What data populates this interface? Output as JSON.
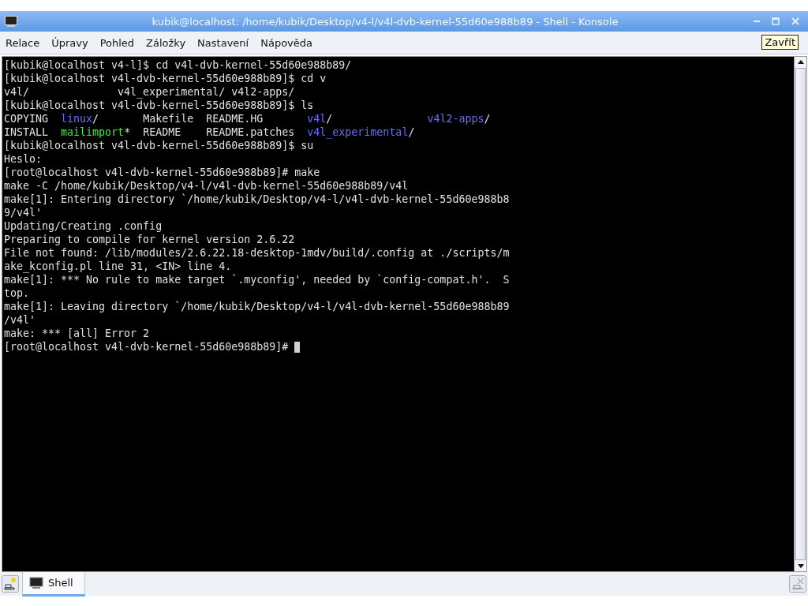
{
  "window": {
    "title": "kubik@localhost: /home/kubik/Desktop/v4-l/v4l-dvb-kernel-55d60e988b89 - Shell - Konsole"
  },
  "menu": [
    "Relace",
    "Úpravy",
    "Pohled",
    "Záložky",
    "Nastavení",
    "Nápověda"
  ],
  "tooltip": "Zavřít",
  "terminal": {
    "lines": [
      {
        "spans": [
          {
            "kind": "text",
            "text": "[kubik@localhost v4-l]$ cd v4l-dvb-kernel-55d60e988b89/"
          }
        ]
      },
      {
        "spans": [
          {
            "kind": "text",
            "text": "[kubik@localhost v4l-dvb-kernel-55d60e988b89]$ cd v"
          }
        ]
      },
      {
        "spans": [
          {
            "kind": "text",
            "text": "v4l/              v4l_experimental/ v4l2-apps/"
          }
        ]
      },
      {
        "spans": [
          {
            "kind": "text",
            "text": "[kubik@localhost v4l-dvb-kernel-55d60e988b89]$ ls"
          }
        ]
      },
      {
        "spans": [
          {
            "kind": "text",
            "text": "COPYING  "
          },
          {
            "kind": "dir",
            "text": "linux"
          },
          {
            "kind": "text",
            "text": "/       Makefile  README.HG       "
          },
          {
            "kind": "dir",
            "text": "v4l"
          },
          {
            "kind": "text",
            "text": "/               "
          },
          {
            "kind": "dir",
            "text": "v4l2-apps"
          },
          {
            "kind": "text",
            "text": "/"
          }
        ]
      },
      {
        "spans": [
          {
            "kind": "text",
            "text": "INSTALL  "
          },
          {
            "kind": "exec",
            "text": "mailimport"
          },
          {
            "kind": "text",
            "text": "*  README    README.patches  "
          },
          {
            "kind": "dir",
            "text": "v4l_experimental"
          },
          {
            "kind": "text",
            "text": "/"
          }
        ]
      },
      {
        "spans": [
          {
            "kind": "text",
            "text": "[kubik@localhost v4l-dvb-kernel-55d60e988b89]$ su"
          }
        ]
      },
      {
        "spans": [
          {
            "kind": "text",
            "text": "Heslo:"
          }
        ]
      },
      {
        "spans": [
          {
            "kind": "text",
            "text": "[root@localhost v4l-dvb-kernel-55d60e988b89]# make"
          }
        ]
      },
      {
        "spans": [
          {
            "kind": "text",
            "text": "make -C /home/kubik/Desktop/v4-l/v4l-dvb-kernel-55d60e988b89/v4l"
          }
        ]
      },
      {
        "spans": [
          {
            "kind": "text",
            "text": "make[1]: Entering directory `/home/kubik/Desktop/v4-l/v4l-dvb-kernel-55d60e988b8"
          }
        ]
      },
      {
        "spans": [
          {
            "kind": "text",
            "text": "9/v4l'"
          }
        ]
      },
      {
        "spans": [
          {
            "kind": "text",
            "text": "Updating/Creating .config"
          }
        ]
      },
      {
        "spans": [
          {
            "kind": "text",
            "text": "Preparing to compile for kernel version 2.6.22"
          }
        ]
      },
      {
        "spans": [
          {
            "kind": "text",
            "text": "File not found: /lib/modules/2.6.22.18-desktop-1mdv/build/.config at ./scripts/m"
          }
        ]
      },
      {
        "spans": [
          {
            "kind": "text",
            "text": "ake_kconfig.pl line 31, <IN> line 4."
          }
        ]
      },
      {
        "spans": [
          {
            "kind": "text",
            "text": "make[1]: *** No rule to make target `.myconfig', needed by `config-compat.h'.  S"
          }
        ]
      },
      {
        "spans": [
          {
            "kind": "text",
            "text": "top."
          }
        ]
      },
      {
        "spans": [
          {
            "kind": "text",
            "text": "make[1]: Leaving directory `/home/kubik/Desktop/v4-l/v4l-dvb-kernel-55d60e988b89"
          }
        ]
      },
      {
        "spans": [
          {
            "kind": "text",
            "text": "/v4l'"
          }
        ]
      },
      {
        "spans": [
          {
            "kind": "text",
            "text": "make: *** [all] Error 2"
          }
        ]
      },
      {
        "spans": [
          {
            "kind": "text",
            "text": "[root@localhost v4l-dvb-kernel-55d60e988b89]# "
          }
        ],
        "cursor": true
      }
    ]
  },
  "tabs": [
    {
      "label": "Shell",
      "selected": true
    }
  ]
}
